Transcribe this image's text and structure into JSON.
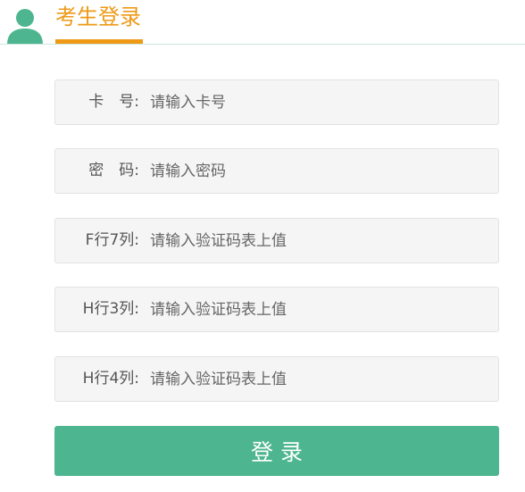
{
  "header": {
    "title": "考生登录",
    "avatar_icon": "user-avatar-icon",
    "title_color": "#ee9a17",
    "avatar_color": "#4db690"
  },
  "form": {
    "fields": [
      {
        "label": "卡　号:",
        "placeholder": "请输入卡号"
      },
      {
        "label": "密　码:",
        "placeholder": "请输入密码"
      },
      {
        "label": "F行7列:",
        "placeholder": "请输入验证码表上值"
      },
      {
        "label": "H行3列:",
        "placeholder": "请输入验证码表上值"
      },
      {
        "label": "H行4列:",
        "placeholder": "请输入验证码表上值"
      }
    ],
    "submit_label": "登录",
    "submit_color": "#4db690"
  }
}
